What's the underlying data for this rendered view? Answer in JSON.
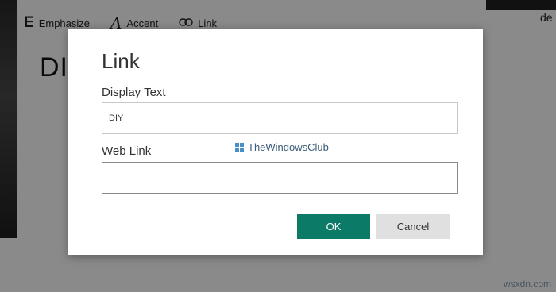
{
  "toolbar": {
    "emphasize_glyph": "E",
    "emphasize_label": "Emphasize",
    "accent_glyph": "A",
    "accent_label": "Accent",
    "link_glyph": "⊂⊃",
    "link_label": "Link"
  },
  "page": {
    "title_partial": "DI",
    "edge_text": "de"
  },
  "dialog": {
    "title": "Link",
    "display_text_label": "Display Text",
    "display_text_value": "DIY",
    "web_link_label": "Web Link",
    "web_link_value": "",
    "ok_label": "OK",
    "cancel_label": "Cancel"
  },
  "watermark": {
    "text": "TheWindowsClub"
  },
  "site_mark": "wsxdn.com",
  "colors": {
    "primary_button": "#0b7a67",
    "secondary_button": "#e0e0e0",
    "overlay": "rgba(0,0,0,0.46)"
  }
}
